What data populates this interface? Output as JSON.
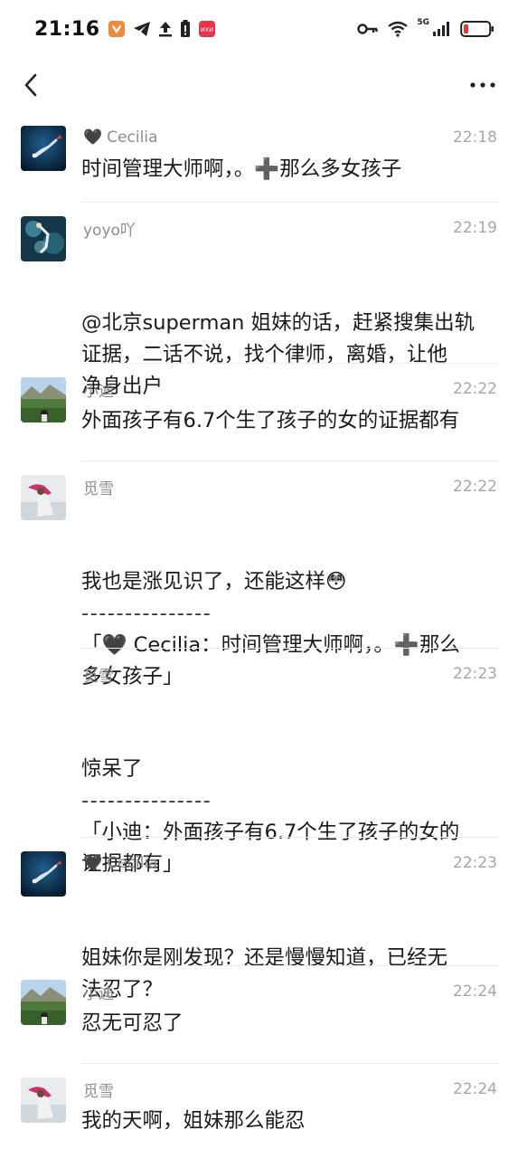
{
  "status_bar": {
    "time": "21:16",
    "network": "5G",
    "icons": [
      "shield-app-icon",
      "telegram-icon",
      "upload-icon",
      "battery-saver-icon",
      "red-app-icon",
      "key-icon",
      "wifi-icon",
      "signal-icon",
      "battery-low-icon"
    ],
    "battery_color": "#e53935"
  },
  "nav": {
    "back_icon": "chevron-left-icon",
    "more_icon": "more-dots-icon"
  },
  "comments": [
    {
      "user": "Cecilia",
      "heart": "🖤",
      "time": "22:18",
      "has_avatar": true,
      "avatar": "diver-avatar",
      "lines": [
        "时间管理大师啊，。➕那么多女孩子"
      ]
    },
    {
      "user": "yoyo吖",
      "time": "22:19",
      "has_avatar": true,
      "avatar": "underwater-avatar",
      "lines": [
        "@北京superman 姐妹的话，赶紧搜集出轨",
        "证据，二话不说，找个律师，离婚，让他",
        "净身出户"
      ]
    },
    {
      "user": "小迪",
      "time": "22:22",
      "has_avatar": true,
      "avatar": "landscape-avatar",
      "lines": [
        "外面孩子有6.7个生了孩子的女的证据都有"
      ]
    },
    {
      "user": "觅雪",
      "time": "22:22",
      "has_avatar": true,
      "avatar": "girl-avatar",
      "lines": [
        "我也是涨见识了，还能这样😳",
        "---------------",
        "「🖤 Cecilia：时间管理大师啊，。➕那么",
        "多女孩子」"
      ]
    },
    {
      "user": "觅雪",
      "time": "22:23",
      "has_avatar": false,
      "lines": [
        "惊呆了",
        "---------------",
        "「小迪：外面孩子有6.7个生了孩子的女的",
        "证据都有」"
      ]
    },
    {
      "user": "Cecilia",
      "heart": "🖤",
      "time": "22:23",
      "has_avatar": true,
      "avatar": "diver-avatar",
      "lines": [
        "姐妹你是刚发现？还是慢慢知道，已经无",
        "法忍了？"
      ]
    },
    {
      "user": "小迪",
      "time": "22:24",
      "has_avatar": true,
      "avatar": "landscape-avatar",
      "lines": [
        "忍无可忍了"
      ]
    },
    {
      "user": "觅雪",
      "time": "22:24",
      "has_avatar": true,
      "avatar": "girl-avatar",
      "lines": [
        "我的天啊，姐妹那么能忍"
      ]
    }
  ]
}
